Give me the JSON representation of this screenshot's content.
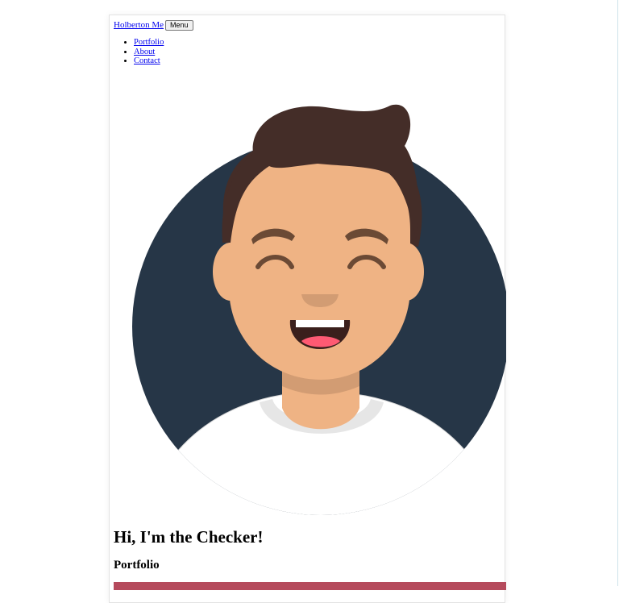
{
  "header": {
    "brand_label": "Holberton Me",
    "menu_button_label": "Menu"
  },
  "nav": {
    "items": [
      {
        "label": "Portfolio"
      },
      {
        "label": "About"
      },
      {
        "label": "Contact"
      }
    ]
  },
  "hero": {
    "title": "Hi, I'm the Checker!"
  },
  "portfolio": {
    "heading": "Portfolio"
  },
  "colors": {
    "avatar_background": "#263647",
    "hair": "#442d28",
    "skin": "#efb384",
    "skin_shadow": "#d29c73",
    "shirt": "#ffffff",
    "collar": "#e6e6e6",
    "tongue": "#ff5a73",
    "accent_bar": "#b54a5c",
    "link": "#0000ee"
  }
}
